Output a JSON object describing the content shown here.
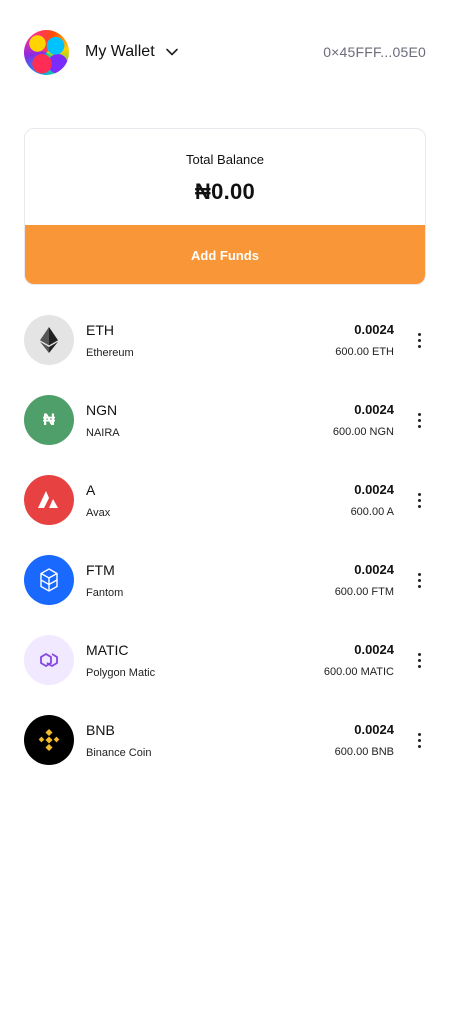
{
  "header": {
    "wallet_label": "My Wallet",
    "address": "0×45FFF...05E0",
    "avatar_icon": "abstract-avatar",
    "chevron_icon": "chevron-down-icon"
  },
  "balance": {
    "label": "Total Balance",
    "value": "₦0.00",
    "add_funds_label": "Add Funds",
    "accent_color": "#f99637"
  },
  "assets": [
    {
      "symbol": "ETH",
      "name": "Ethereum",
      "amount": "0.0024",
      "value": "600.00 ETH",
      "icon": "ethereum-icon",
      "color": "#e4e4e4"
    },
    {
      "symbol": "NGN",
      "name": "NAIRA",
      "amount": "0.0024",
      "value": "600.00 NGN",
      "icon": "naira-icon",
      "glyph": "₦",
      "color": "#4f9f6b"
    },
    {
      "symbol": "A",
      "name": "Avax",
      "amount": "0.0024",
      "value": "600.00 A",
      "icon": "avalanche-icon",
      "color": "#e84142"
    },
    {
      "symbol": "FTM",
      "name": "Fantom",
      "amount": "0.0024",
      "value": "600.00 FTM",
      "icon": "fantom-icon",
      "color": "#1969ff"
    },
    {
      "symbol": "MATIC",
      "name": "Polygon Matic",
      "amount": "0.0024",
      "value": "600.00 MATIC",
      "icon": "polygon-icon",
      "color": "#f0e9ff"
    },
    {
      "symbol": "BNB",
      "name": "Binance Coin",
      "amount": "0.0024",
      "value": "600.00 BNB",
      "icon": "binance-icon",
      "color": "#000000"
    }
  ]
}
